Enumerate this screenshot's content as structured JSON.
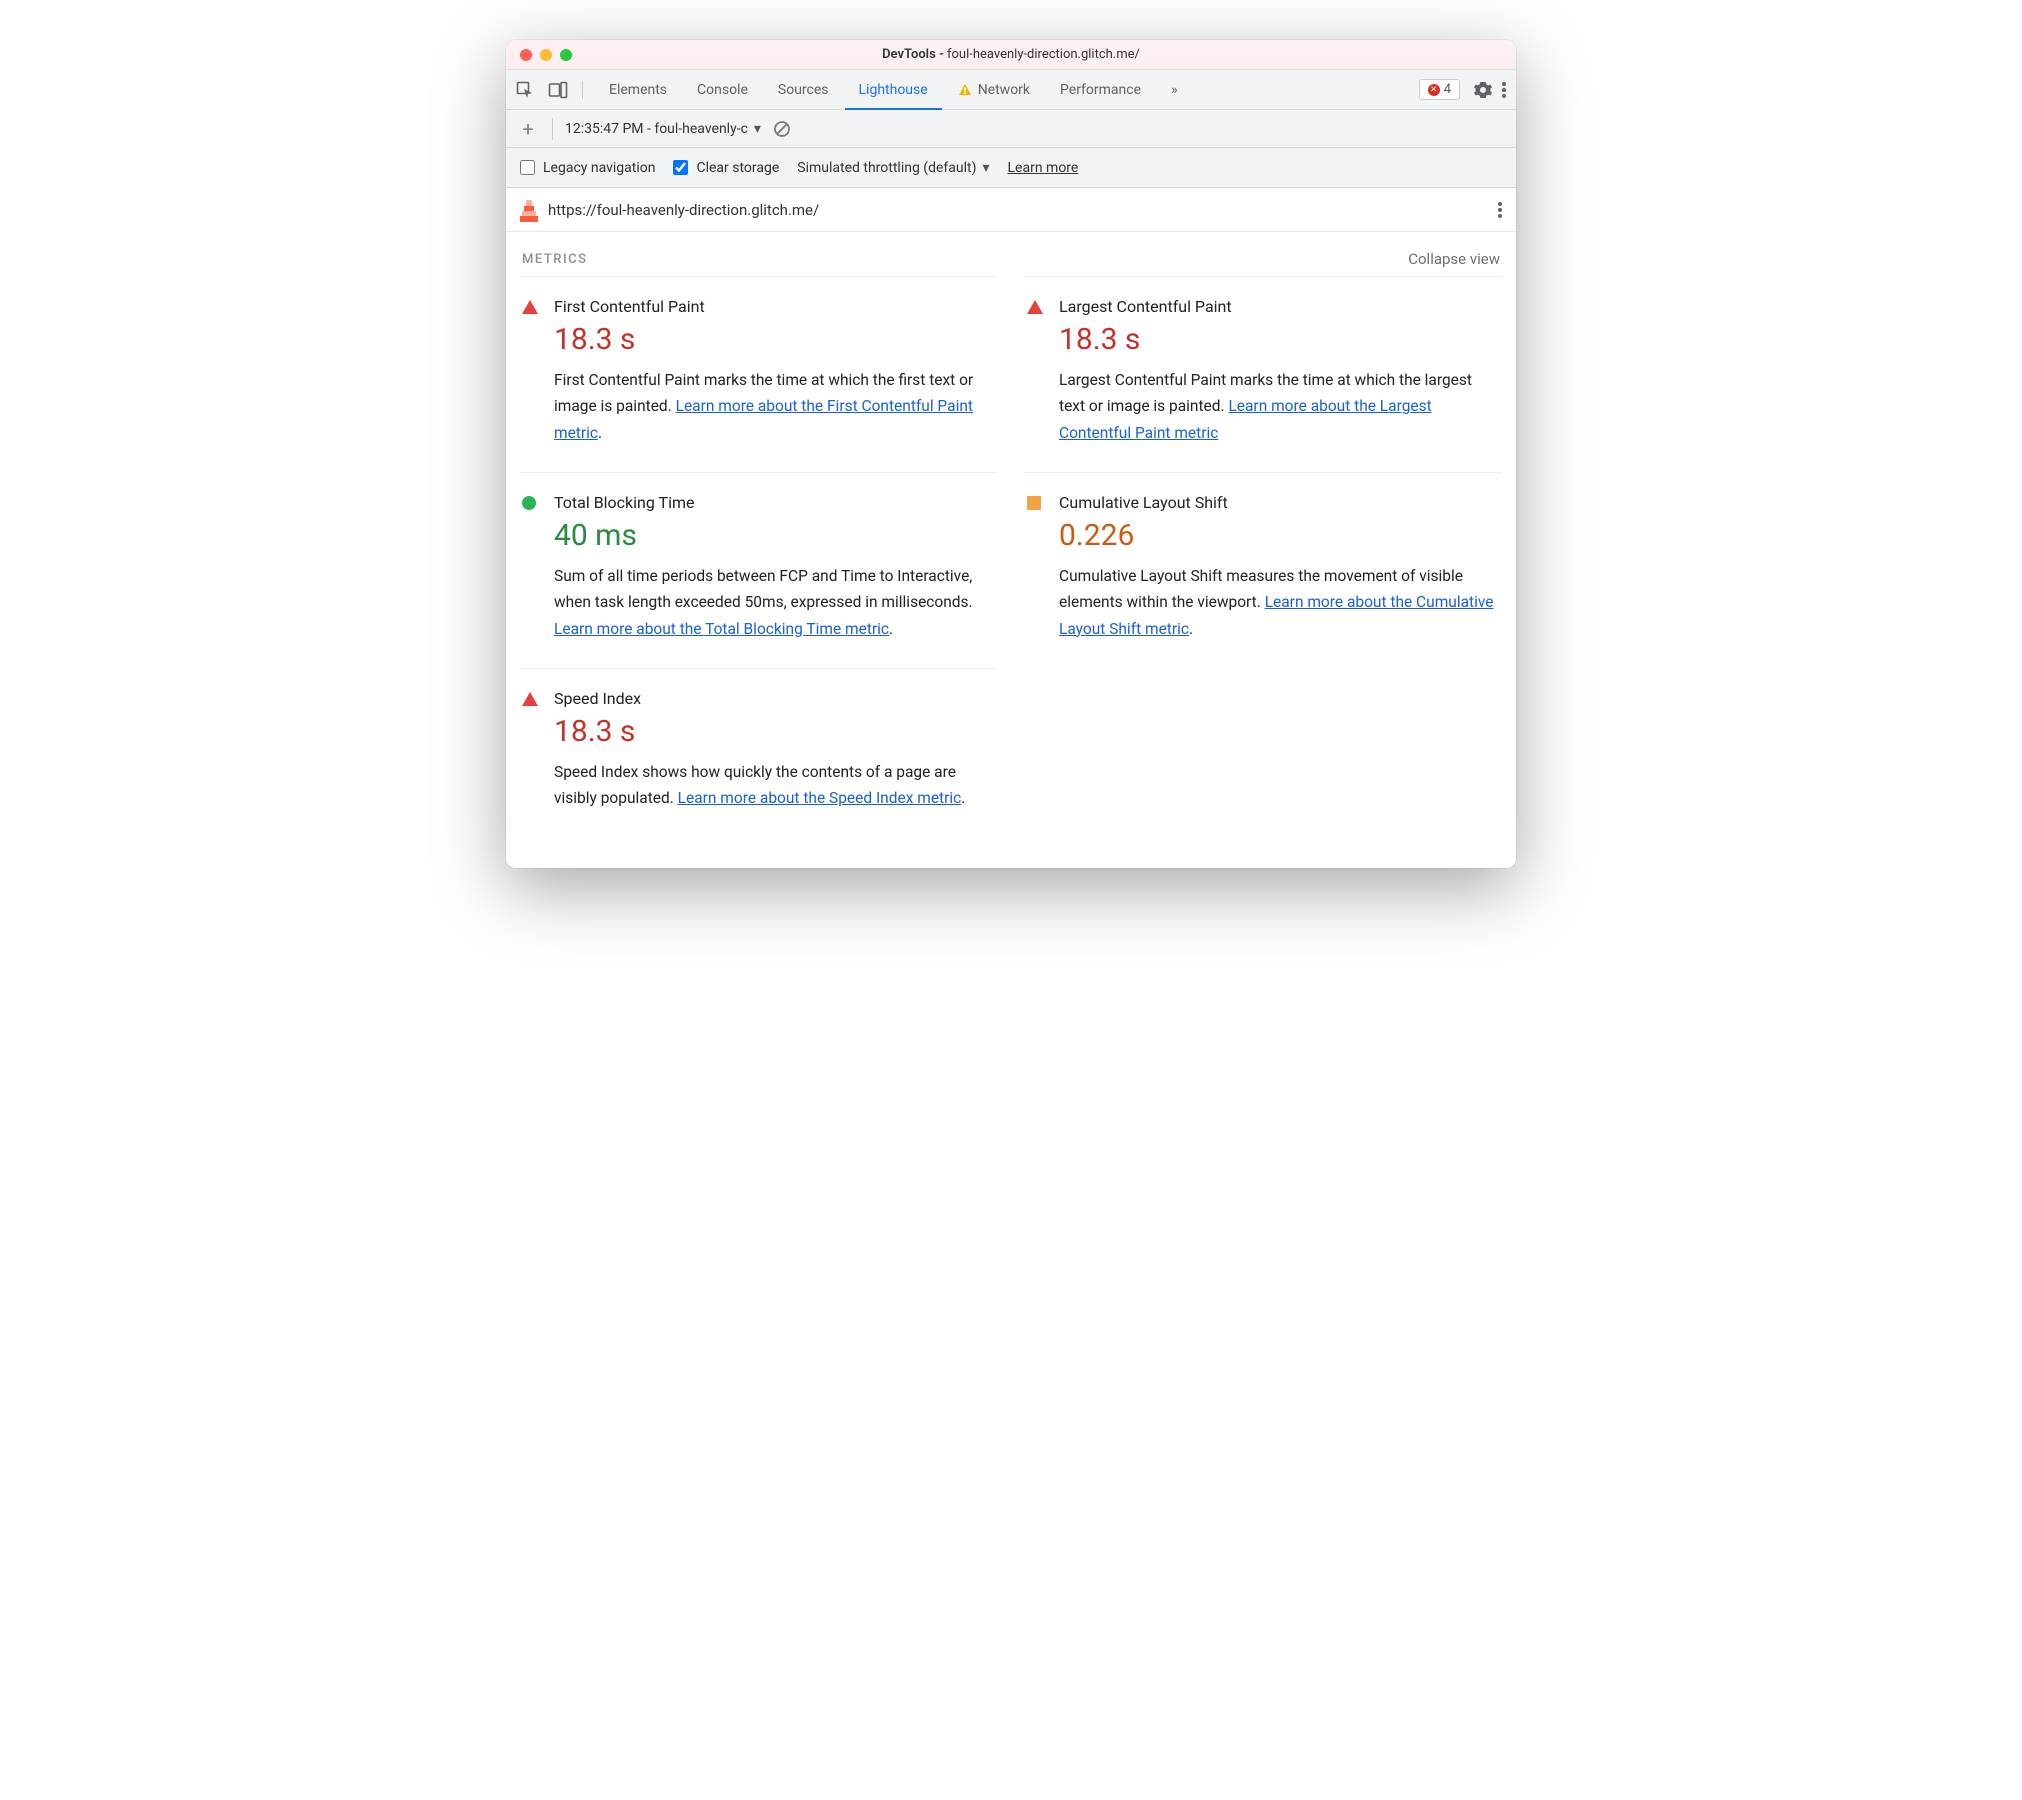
{
  "window": {
    "title_prefix": "DevTools - ",
    "title_target": "foul-heavenly-direction.glitch.me/"
  },
  "tabs": {
    "items": [
      "Elements",
      "Console",
      "Sources",
      "Lighthouse",
      "Network",
      "Performance"
    ],
    "active_index": 3,
    "overflow_glyph": "»",
    "network_has_warning": true
  },
  "errors": {
    "count": "4"
  },
  "report_selector": {
    "label": "12:35:47 PM - foul-heavenly-c"
  },
  "options": {
    "legacy_label": "Legacy navigation",
    "legacy_checked": false,
    "clear_label": "Clear storage",
    "clear_checked": true,
    "throttling_label": "Simulated throttling (default)",
    "learn_more": "Learn more"
  },
  "url": "https://foul-heavenly-direction.glitch.me/",
  "metrics_section": {
    "heading": "METRICS",
    "collapse": "Collapse view"
  },
  "metrics": {
    "fcp": {
      "title": "First Contentful Paint",
      "value": "18.3 s",
      "status": "red",
      "desc": "First Contentful Paint marks the time at which the first text or image is painted. ",
      "link": "Learn more about the First Contentful Paint metric",
      "trail": "."
    },
    "lcp": {
      "title": "Largest Contentful Paint",
      "value": "18.3 s",
      "status": "red",
      "desc": "Largest Contentful Paint marks the time at which the largest text or image is painted. ",
      "link": "Learn more about the Largest Contentful Paint metric",
      "trail": ""
    },
    "tbt": {
      "title": "Total Blocking Time",
      "value": "40 ms",
      "status": "green",
      "desc": "Sum of all time periods between FCP and Time to Interactive, when task length exceeded 50ms, expressed in milliseconds. ",
      "link": "Learn more about the Total Blocking Time metric",
      "trail": "."
    },
    "cls": {
      "title": "Cumulative Layout Shift",
      "value": "0.226",
      "status": "orange",
      "desc": "Cumulative Layout Shift measures the movement of visible elements within the viewport. ",
      "link": "Learn more about the Cumulative Layout Shift metric",
      "trail": "."
    },
    "si": {
      "title": "Speed Index",
      "value": "18.3 s",
      "status": "red",
      "desc": "Speed Index shows how quickly the contents of a page are visibly populated. ",
      "link": "Learn more about the Speed Index metric",
      "trail": "."
    }
  }
}
